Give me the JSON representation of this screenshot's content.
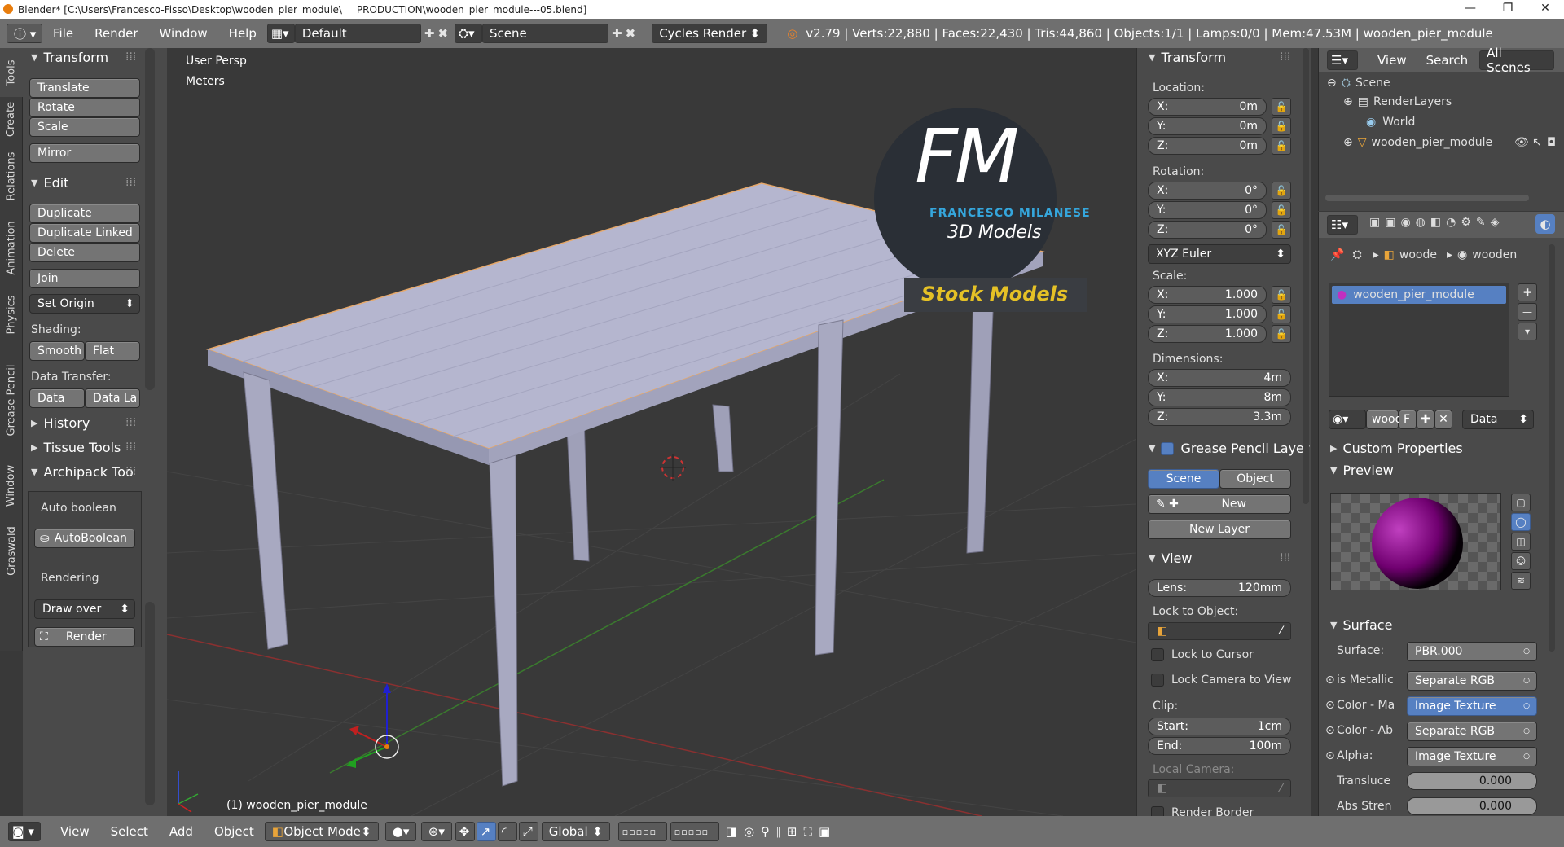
{
  "window": {
    "title": "Blender* [C:\\Users\\Francesco-Fisso\\Desktop\\wooden_pier_module\\___PRODUCTION\\wooden_pier_module---05.blend]",
    "min": "—",
    "max": "❐",
    "close": "✕"
  },
  "header": {
    "menus": [
      "File",
      "Render",
      "Window",
      "Help"
    ],
    "layout": "Default",
    "scene": "Scene",
    "engine": "Cycles Render",
    "stats": "v2.79 | Verts:22,880 | Faces:22,430 | Tris:44,860 | Objects:1/1 | Lamps:0/0 | Mem:47.53M | wooden_pier_module"
  },
  "tool_tabs": [
    "Tools",
    "Create",
    "Relations",
    "Animation",
    "Physics",
    "Grease Pencil",
    "Window",
    "Graswald"
  ],
  "toolshelf": {
    "transform": {
      "title": "Transform",
      "translate": "Translate",
      "rotate": "Rotate",
      "scale": "Scale",
      "mirror": "Mirror"
    },
    "edit": {
      "title": "Edit",
      "duplicate": "Duplicate",
      "duplicate_linked": "Duplicate Linked",
      "delete": "Delete",
      "join": "Join",
      "set_origin": "Set Origin",
      "shading_label": "Shading:",
      "smooth": "Smooth",
      "flat": "Flat",
      "data_transfer_label": "Data Transfer:",
      "data": "Data",
      "data_la": "Data La"
    },
    "history": "History",
    "tissue": "Tissue Tools",
    "archipack": {
      "title": "Archipack Too",
      "auto_boolean_label": "Auto boolean",
      "auto_boolean_btn": "AutoBoolean",
      "rendering_label": "Rendering",
      "draw_over": "Draw over",
      "render": "Render"
    }
  },
  "viewport": {
    "view_name": "User Persp",
    "units": "Meters",
    "object_label": "(1) wooden_pier_module",
    "watermark": {
      "letters": "FM",
      "brand": "FRANCESCO MILANESE",
      "tag": "3D Models",
      "ribbon": "Stock Models"
    }
  },
  "npanel": {
    "transform_title": "Transform",
    "location_label": "Location:",
    "location": [
      {
        "axis": "X:",
        "value": "0m"
      },
      {
        "axis": "Y:",
        "value": "0m"
      },
      {
        "axis": "Z:",
        "value": "0m"
      }
    ],
    "rotation_label": "Rotation:",
    "rotation": [
      {
        "axis": "X:",
        "value": "0°"
      },
      {
        "axis": "Y:",
        "value": "0°"
      },
      {
        "axis": "Z:",
        "value": "0°"
      }
    ],
    "rotation_mode": "XYZ Euler",
    "scale_label": "Scale:",
    "scale": [
      {
        "axis": "X:",
        "value": "1.000"
      },
      {
        "axis": "Y:",
        "value": "1.000"
      },
      {
        "axis": "Z:",
        "value": "1.000"
      }
    ],
    "dimensions_label": "Dimensions:",
    "dimensions": [
      {
        "axis": "X:",
        "value": "4m"
      },
      {
        "axis": "Y:",
        "value": "8m"
      },
      {
        "axis": "Z:",
        "value": "3.3m"
      }
    ],
    "grease_title": "Grease Pencil Layer",
    "grease_scene": "Scene",
    "grease_object": "Object",
    "grease_new": "New",
    "grease_new_layer": "New Layer",
    "view_title": "View",
    "lens_label": "Lens:",
    "lens_value": "120mm",
    "lock_to_object": "Lock to Object:",
    "lock_cursor": "Lock to Cursor",
    "lock_camera": "Lock Camera to View",
    "clip_label": "Clip:",
    "clip_start_label": "Start:",
    "clip_start": "1cm",
    "clip_end_label": "End:",
    "clip_end": "100m",
    "local_camera": "Local Camera:",
    "render_border": "Render Border"
  },
  "outliner": {
    "view": "View",
    "search": "Search",
    "all_scenes": "All Scenes",
    "items": [
      "Scene",
      "RenderLayers",
      "World",
      "wooden_pier_module"
    ]
  },
  "properties": {
    "breadcrumb": [
      "woode",
      "wooden"
    ],
    "material_slot": "wooden_pier_module",
    "mat_name": "wood",
    "mat_f": "F",
    "link": "Data",
    "custom_props": "Custom Properties",
    "preview": "Preview",
    "surface_title": "Surface",
    "surface_label": "Surface:",
    "surface_value": "PBR.000",
    "rows": [
      {
        "label": "is Metallic",
        "value": "Separate RGB"
      },
      {
        "label": "Color - Ma",
        "value": "Image Texture"
      },
      {
        "label": "Color - Ab",
        "value": "Separate RGB"
      },
      {
        "label": "Alpha:",
        "value": "Image Texture"
      }
    ],
    "translu_label": "Transluce",
    "translu_value": "0.000",
    "abs_label": "Abs Stren",
    "abs_value": "0.000"
  },
  "bottom": {
    "view": "View",
    "select": "Select",
    "add": "Add",
    "object": "Object",
    "mode": "Object Mode",
    "orientation": "Global"
  }
}
